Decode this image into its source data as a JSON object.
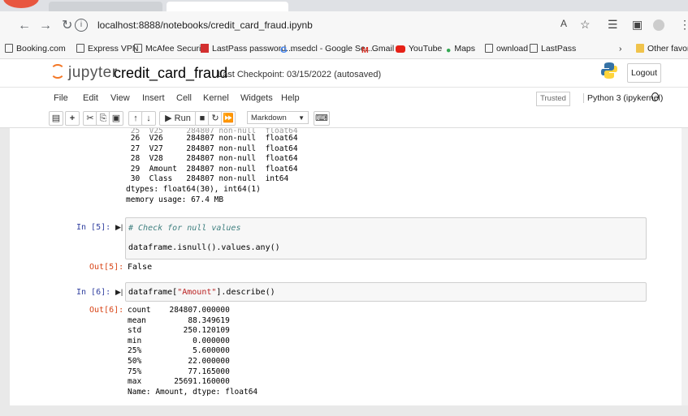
{
  "browser": {
    "url": "localhost:8888/notebooks/credit_card_fraud.ipynb",
    "bookmarks": [
      "Booking.com",
      "Express VPN",
      "McAfee Security",
      "LastPass password...",
      "msedcl - Google Se...",
      "Gmail",
      "YouTube",
      "Maps",
      "ownload",
      "LastPass",
      "Other favor"
    ]
  },
  "jupyter": {
    "logo_text": "jupyter",
    "title": "credit_card_fraud",
    "checkpoint": "Last Checkpoint: 03/15/2022  (autosaved)",
    "logout": "Logout",
    "menus": [
      "File",
      "Edit",
      "View",
      "Insert",
      "Cell",
      "Kernel",
      "Widgets",
      "Help"
    ],
    "trusted": "Trusted",
    "kernel": "Python 3 (ipykernel)",
    "run_label": "Run",
    "cell_type": "Markdown"
  },
  "cells": {
    "info_output": " 26  V26     284807 non-null  float64\n 27  V27     284807 non-null  float64\n 28  V28     284807 non-null  float64\n 29  Amount  284807 non-null  float64\n 30  Class   284807 non-null  int64\ndtypes: float64(30), int64(1)\nmemory usage: 67.4 MB",
    "cell5_prompt": "In [5]:",
    "cell5_comment": "# Check for null values",
    "cell5_code": "dataframe.isnull().values.any()",
    "cell5_out_prompt": "Out[5]:",
    "cell5_output": "False",
    "cell6_prompt": "In [6]:",
    "cell6_code_pre": "dataframe[",
    "cell6_code_str": "\"Amount\"",
    "cell6_code_post": "].describe()",
    "cell6_out_prompt": "Out[6]:",
    "cell6_output": "count    284807.000000\nmean         88.349619\nstd         250.120109\nmin           0.000000\n25%           5.600000\n50%          22.000000\n75%          77.165000\nmax       25691.160000\nName: Amount, dtype: float64"
  }
}
